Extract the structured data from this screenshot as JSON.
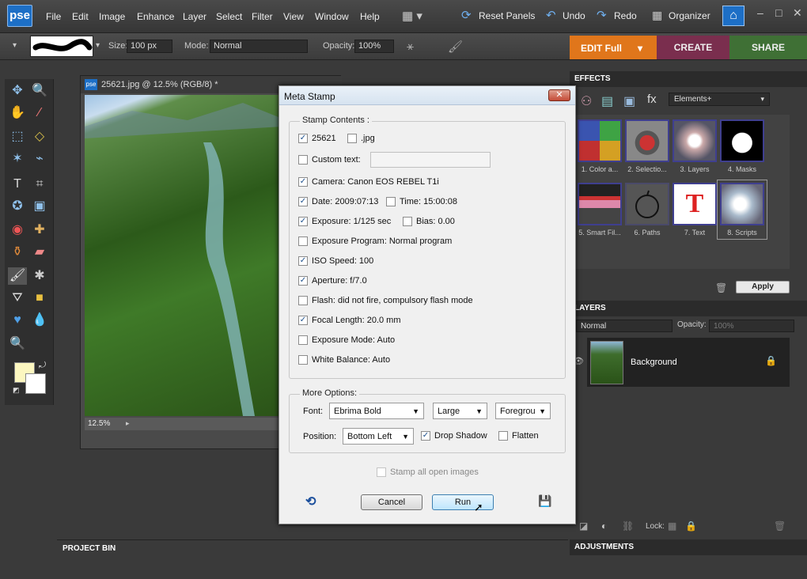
{
  "app": {
    "logo": "pse",
    "menu": [
      "File",
      "Edit",
      "Image",
      "Enhance",
      "Layer",
      "Select",
      "Filter",
      "View",
      "Window",
      "Help"
    ],
    "reset_panels": "Reset Panels",
    "undo": "Undo",
    "redo": "Redo",
    "organizer": "Organizer"
  },
  "options": {
    "size_label": "Size:",
    "size_value": "100 px",
    "mode_label": "Mode:",
    "mode_value": "Normal",
    "opacity_label": "Opacity:",
    "opacity_value": "100%"
  },
  "tabs": {
    "edit": "EDIT Full",
    "create": "CREATE",
    "share": "SHARE"
  },
  "document": {
    "title": "25621.jpg @ 12.5% (RGB/8) *",
    "zoom": "12.5%"
  },
  "project_bin": "PROJECT BIN",
  "effects": {
    "header": "EFFECTS",
    "dropdown": "Elements+",
    "items": [
      "1. Color a...",
      "2. Selectio...",
      "3. Layers",
      "4. Masks",
      "5. Smart Fil...",
      "6. Paths",
      "7. Text",
      "8. Scripts"
    ],
    "apply": "Apply"
  },
  "layers": {
    "header": "LAYERS",
    "blend": "Normal",
    "opacity_label": "Opacity:",
    "opacity_value": "100%",
    "layer_name": "Background",
    "lock_label": "Lock:"
  },
  "adjustments": "ADJUSTMENTS",
  "dialog": {
    "title": "Meta Stamp",
    "stamp_contents_label": "Stamp Contents :",
    "file_name": "25621",
    "ext": ".jpg",
    "custom_text": "Custom text:",
    "camera": "Camera: Canon EOS REBEL T1i",
    "date": "Date: 2009:07:13",
    "time": "Time: 15:00:08",
    "exposure": "Exposure: 1/125 sec",
    "bias": "Bias: 0.00",
    "exposure_program": "Exposure Program: Normal program",
    "iso": "ISO Speed: 100",
    "aperture": "Aperture: f/7.0",
    "flash": "Flash: did not fire, compulsory flash mode",
    "focal": "Focal Length: 20.0 mm",
    "exposure_mode": "Exposure Mode: Auto",
    "white_balance": "White Balance: Auto",
    "more_options_label": "More Options:",
    "font_label": "Font:",
    "font_value": "Ebrima Bold",
    "size_value": "Large",
    "color_value": "Foregrou",
    "position_label": "Position:",
    "position_value": "Bottom Left",
    "drop_shadow": "Drop Shadow",
    "flatten": "Flatten",
    "stamp_all": "Stamp all open images",
    "cancel": "Cancel",
    "run": "Run"
  }
}
